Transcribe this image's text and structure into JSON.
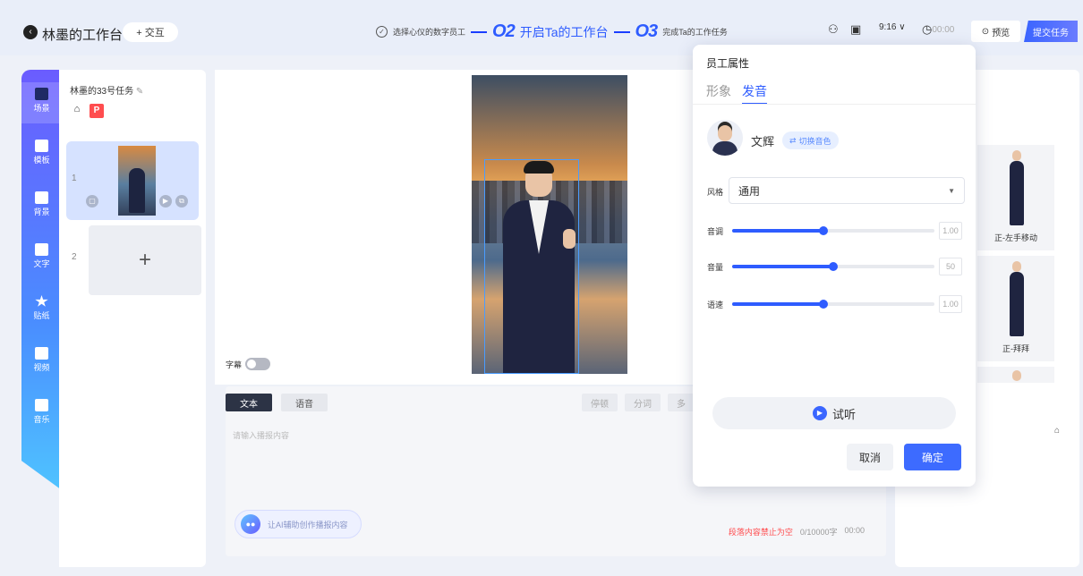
{
  "header": {
    "app_title": "林墨的工作台",
    "interact_label": "+ 交互",
    "step1": "选择心仪的数字员工",
    "step2_num": "O2",
    "step2": "开启Ta的工作台",
    "step3_num": "O3",
    "step3": "完成Ta的工作任务",
    "ratio": "9:16",
    "timer": "00:00",
    "preview_label": "预览",
    "submit_label": "提交任务",
    "colors": {
      "accent": "#2e5cff",
      "background": "#e9eef9"
    }
  },
  "nav": {
    "items": [
      {
        "label": "场景",
        "icon": "scene-icon",
        "active": true
      },
      {
        "label": "模板",
        "icon": "template-icon"
      },
      {
        "label": "背景",
        "icon": "image-icon"
      },
      {
        "label": "文字",
        "icon": "text-icon"
      },
      {
        "label": "贴纸",
        "icon": "star-icon"
      },
      {
        "label": "视频",
        "icon": "video-icon"
      },
      {
        "label": "音乐",
        "icon": "music-icon"
      }
    ]
  },
  "scenes": {
    "task_title": "林墨的33号任务",
    "items": [
      {
        "num": "1"
      },
      {
        "num": "2"
      }
    ],
    "add_label": "+"
  },
  "canvas": {
    "subtitle_label": "字幕"
  },
  "editor": {
    "tabs": [
      "文本",
      "语音"
    ],
    "tools": [
      "停顿",
      "分词",
      "多"
    ],
    "placeholder": "请输入播报内容",
    "ai_label": "让AI辅助创作播报内容",
    "error": "段落内容禁止为空",
    "count": "0/10000字",
    "duration": "00:00"
  },
  "right_panel": {
    "actions": [
      "正-左手移动",
      "正-拜拜"
    ]
  },
  "popup": {
    "title": "员工属性",
    "tabs": [
      "形象",
      "发音"
    ],
    "voice_name": "文辉",
    "switch_label": "切换音色",
    "style_label": "风格",
    "style_value": "通用",
    "sliders": [
      {
        "label": "音调",
        "value": "1.00",
        "level": 0.45
      },
      {
        "label": "音量",
        "value": "50",
        "level": 0.5
      },
      {
        "label": "语速",
        "value": "1.00",
        "level": 0.45
      }
    ],
    "listen_label": "试听",
    "cancel_label": "取消",
    "ok_label": "确定"
  }
}
